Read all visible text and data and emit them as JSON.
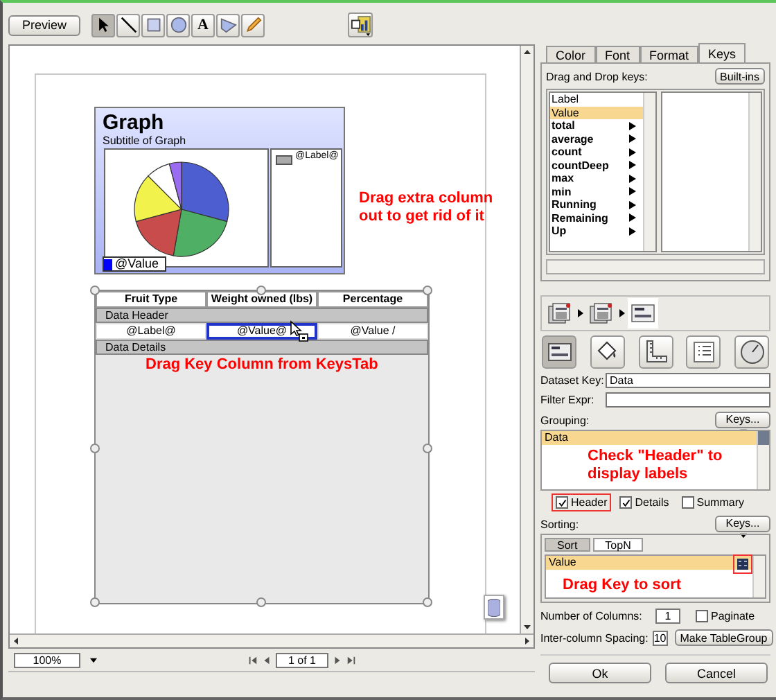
{
  "toolbar": {
    "preview_button": "Preview",
    "tools": [
      {
        "kind": "pointer",
        "selected": true
      },
      {
        "kind": "line",
        "selected": false
      },
      {
        "kind": "rectangle",
        "selected": false
      },
      {
        "kind": "ellipse",
        "selected": false
      },
      {
        "kind": "text",
        "label": "A",
        "selected": false
      },
      {
        "kind": "polygon",
        "selected": false
      },
      {
        "kind": "pencil",
        "selected": false
      }
    ]
  },
  "report": {
    "graph": {
      "title": "Graph",
      "subtitle": "Subtitle of Graph",
      "legend_label": "@Label@",
      "value_label": "@Value"
    },
    "table": {
      "columns": [
        "Fruit Type",
        "Weight owned (lbs)",
        "Percentage"
      ],
      "rows": [
        {
          "kind": "band",
          "label": "Data Header"
        },
        {
          "kind": "cells",
          "cells": [
            {
              "text": "@Label@",
              "selected": false
            },
            {
              "text": "@Value@",
              "selected": true
            },
            {
              "text": "@Value /",
              "selected": false
            }
          ]
        },
        {
          "kind": "band",
          "label": "Data Details"
        }
      ]
    },
    "notes": [
      "Drag extra column out to get rid of it",
      "Drag Key Column from KeysTab"
    ]
  },
  "navigation": {
    "zoom": "100%",
    "page": "1 of 1"
  },
  "inspector": {
    "tabs": [
      {
        "label": "Color",
        "selected": false
      },
      {
        "label": "Font",
        "selected": false
      },
      {
        "label": "Format",
        "selected": false
      },
      {
        "label": "Keys",
        "selected": true
      }
    ],
    "keys_label": "Drag and Drop keys:",
    "builtins_button": "Built-ins",
    "keys": [
      {
        "label": "Label",
        "kind": "field",
        "selected": false
      },
      {
        "label": "Value",
        "kind": "field",
        "selected": true
      },
      {
        "label": "total",
        "kind": "aggregate",
        "selected": false
      },
      {
        "label": "average",
        "kind": "aggregate",
        "selected": false
      },
      {
        "label": "count",
        "kind": "aggregate",
        "selected": false
      },
      {
        "label": "countDeep",
        "kind": "aggregate",
        "selected": false
      },
      {
        "label": "max",
        "kind": "aggregate",
        "selected": false
      },
      {
        "label": "min",
        "kind": "aggregate",
        "selected": false
      },
      {
        "label": "Running",
        "kind": "aggregate",
        "selected": false
      },
      {
        "label": "Remaining",
        "kind": "aggregate",
        "selected": false
      },
      {
        "label": "Up",
        "kind": "aggregate",
        "selected": false
      }
    ],
    "path": [
      {
        "selected": false
      },
      {
        "selected": false
      },
      {
        "selected": true
      }
    ],
    "views": [
      {
        "kind": "band",
        "selected": true
      },
      {
        "kind": "paint",
        "selected": false
      },
      {
        "kind": "ruler",
        "selected": false
      },
      {
        "kind": "list",
        "selected": false
      },
      {
        "kind": "dial",
        "selected": false
      }
    ],
    "dataset_key_label": "Dataset Key:",
    "dataset_key": "Data",
    "filter_label": "Filter Expr:",
    "grouping_label": "Grouping:",
    "grouping_keys_button": "Keys...",
    "grouping": [
      {
        "label": "Data",
        "selected": true
      }
    ],
    "grouping_note": "Check \"Header\" to display labels",
    "options": [
      {
        "label": "Header",
        "checked": true,
        "highlighted": true
      },
      {
        "label": "Details",
        "checked": true,
        "highlighted": false
      },
      {
        "label": "Summary",
        "checked": false,
        "highlighted": false
      }
    ],
    "sorting_label": "Sorting:",
    "sorting_keys_button": "Keys...",
    "sorting_tabs": [
      {
        "label": "Sort",
        "selected": true
      },
      {
        "label": "TopN",
        "selected": false
      }
    ],
    "sort_keys": [
      {
        "label": "Value",
        "selected": true
      }
    ],
    "sort_icon_highlighted": true,
    "sorting_note": "Drag Key to sort",
    "columns_label": "Number of Columns:",
    "columns": "1",
    "paginate": {
      "label": "Paginate",
      "checked": false
    },
    "spacing_label": "Inter-column Spacing:",
    "spacing": "10",
    "make_group_button": "Make TableGroup"
  },
  "buttons": [
    "Ok",
    "Cancel"
  ]
}
